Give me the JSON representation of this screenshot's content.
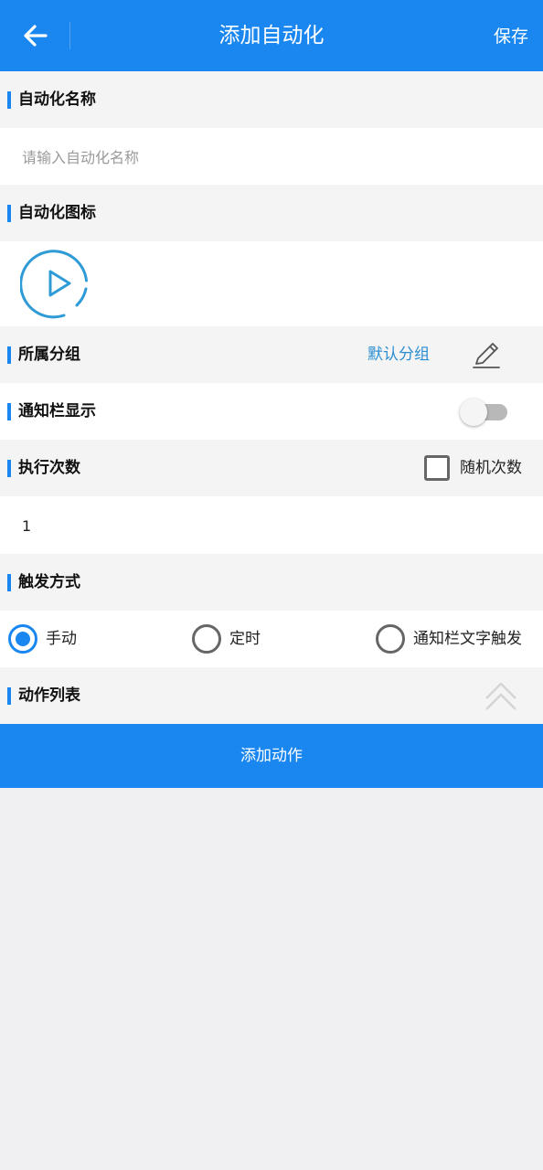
{
  "header": {
    "title": "添加自动化",
    "save_label": "保存",
    "back_icon": "arrow-left-icon"
  },
  "sections": {
    "name": {
      "label": "自动化名称",
      "placeholder": "请输入自动化名称",
      "value": ""
    },
    "icon": {
      "label": "自动化图标",
      "selected_icon": "play-circle-icon"
    },
    "group": {
      "label": "所属分组",
      "value": "默认分组",
      "edit_icon": "pencil-icon"
    },
    "notification": {
      "label": "通知栏显示",
      "enabled": false
    },
    "exec_count": {
      "label": "执行次数",
      "random_label": "随机次数",
      "random_checked": false,
      "value": "1"
    },
    "trigger": {
      "label": "触发方式",
      "options": [
        {
          "label": "手动",
          "selected": true
        },
        {
          "label": "定时",
          "selected": false
        },
        {
          "label": "通知栏文字触发",
          "selected": false
        }
      ]
    },
    "actions": {
      "label": "动作列表",
      "collapse_icon": "double-chevron-up-icon"
    }
  },
  "add_action_label": "添加动作",
  "colors": {
    "primary": "#1a87f0",
    "link": "#2b8ed2",
    "icon_teal": "#2f9bd6",
    "section_bg": "#f4f4f4",
    "page_bg": "#f0f0f2"
  }
}
